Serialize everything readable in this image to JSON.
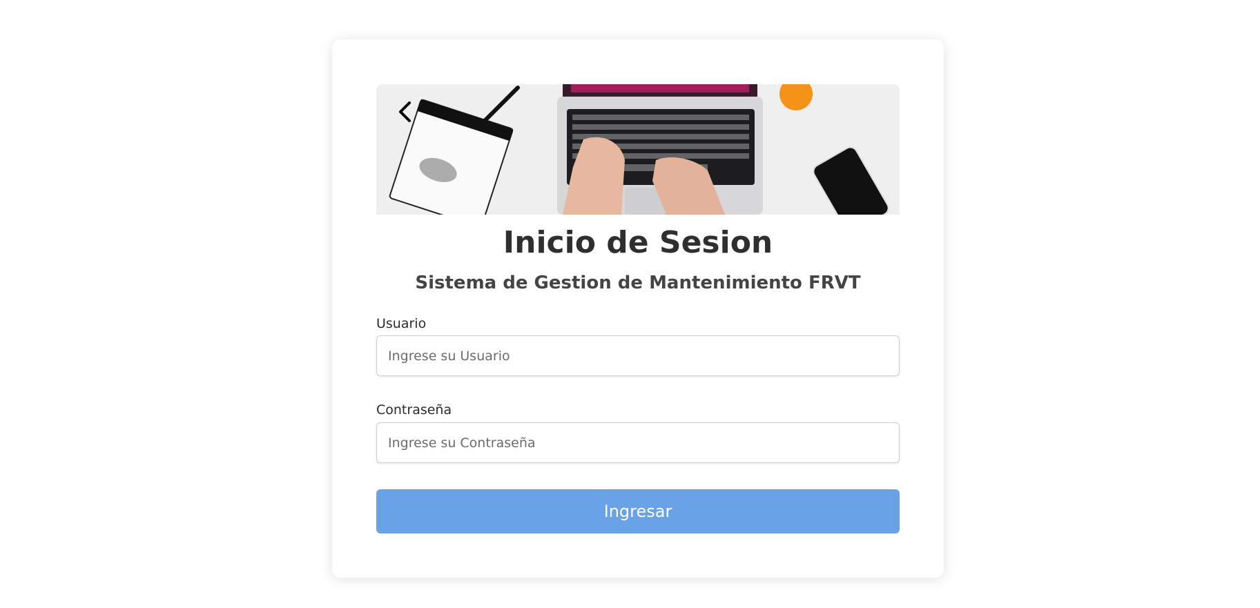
{
  "login": {
    "title": "Inicio de Sesion",
    "subtitle": "Sistema de Gestion de Mantenimiento FRVT",
    "username": {
      "label": "Usuario",
      "placeholder": "Ingrese su Usuario",
      "value": ""
    },
    "password": {
      "label": "Contraseña",
      "placeholder": "Ingrese su Contraseña",
      "value": ""
    },
    "submit_label": "Ingresar",
    "hero_image": "desk-laptop-photo",
    "back_icon": "chevron-left-icon"
  },
  "colors": {
    "background": "#ffffff",
    "card": "#ffffff",
    "button": "#6aa2e6",
    "button_text": "#ffffff",
    "title_text": "#2f2f2f"
  }
}
